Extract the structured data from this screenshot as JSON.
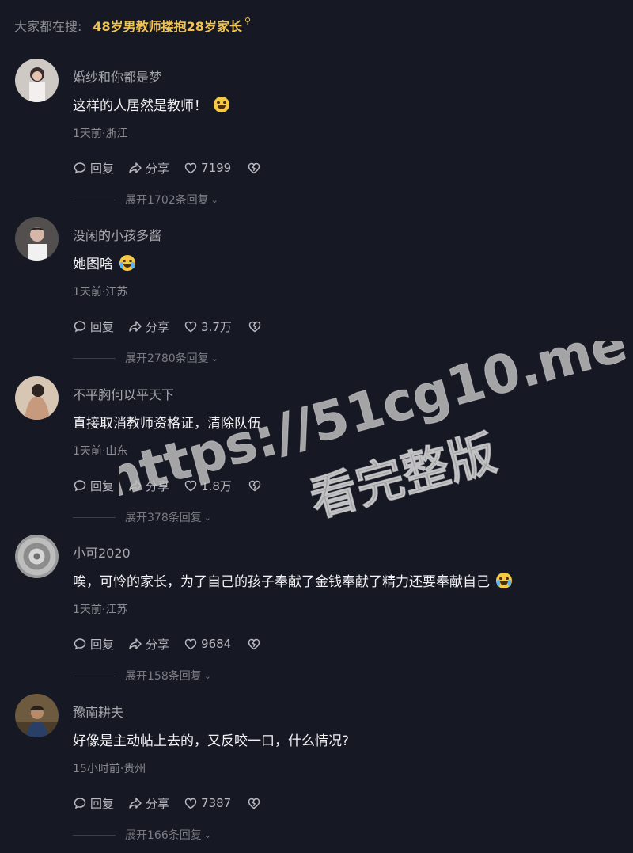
{
  "search": {
    "prefix": "大家都在搜:",
    "term": "48岁男教师搂抱28岁家长"
  },
  "actions": {
    "reply": "回复",
    "share": "分享"
  },
  "comments": [
    {
      "username": "婚纱和你都是梦",
      "text": "这样的人居然是教师！",
      "emoji": "laughing-crying-emoji",
      "meta": "1天前·浙江",
      "likes": "7199",
      "replies": "展开1702条回复"
    },
    {
      "username": "没闲的小孩多酱",
      "text": "她图啥",
      "emoji": "crying-emoji",
      "meta": "1天前·江苏",
      "likes": "3.7万",
      "replies": "展开2780条回复"
    },
    {
      "username": "不平胸何以平天下",
      "text": "直接取消教师资格证，清除队伍",
      "emoji": "",
      "meta": "1天前·山东",
      "likes": "1.8万",
      "replies": "展开378条回复"
    },
    {
      "username": "小可2020",
      "text": "唉，可怜的家长，为了自己的孩子奉献了金钱奉献了精力还要奉献自己",
      "emoji": "crying-emoji",
      "meta": "1天前·江苏",
      "likes": "9684",
      "replies": "展开158条回复"
    },
    {
      "username": "豫南耕夫",
      "text": "好像是主动帖上去的，又反咬一口，什么情况?",
      "emoji": "",
      "meta": "15小时前·贵州",
      "likes": "7387",
      "replies": "展开166条回复"
    }
  ],
  "watermark": {
    "line1": "https://51cg10.me",
    "line2": "看完整版"
  },
  "colors": {
    "background": "#161823",
    "search_term": "#f0c454",
    "username": "#a5a6ab",
    "text": "#f2f2f4",
    "meta": "#8a8b91"
  }
}
